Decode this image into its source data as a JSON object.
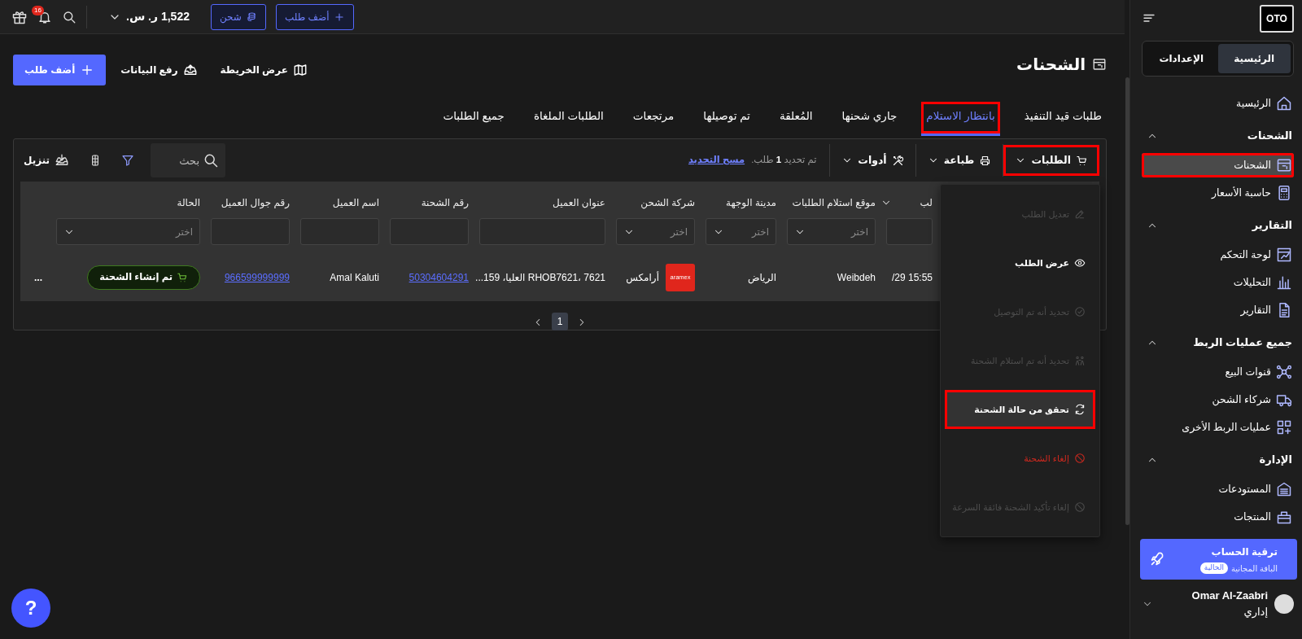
{
  "topbar": {
    "buttons": [
      {
        "label": "أضف طلب",
        "kind": "add"
      },
      {
        "label": "شحن",
        "kind": "charge"
      }
    ],
    "balance": "1,522 ر. س.",
    "notifications": "16"
  },
  "page": {
    "title": "الشحنات",
    "actions": [
      {
        "label": "عرض الخريطة",
        "kind": "map"
      },
      {
        "label": "رفع البيانات",
        "kind": "upload"
      },
      {
        "label": "أضف طلب",
        "kind": "primary"
      }
    ]
  },
  "tabs": [
    {
      "label": "طلبات قيد التنفيذ",
      "selected": false,
      "highlighted": false
    },
    {
      "label": "بانتظار الاستلام",
      "selected": true,
      "highlighted": true
    },
    {
      "label": "جاري شحنها",
      "selected": false,
      "highlighted": false
    },
    {
      "label": "المُعلقة",
      "selected": false,
      "highlighted": false
    },
    {
      "label": "تم توصيلها",
      "selected": false,
      "highlighted": false
    },
    {
      "label": "مرتجعات",
      "selected": false,
      "highlighted": false
    },
    {
      "label": "الطلبات الملغاة",
      "selected": false,
      "highlighted": false
    },
    {
      "label": "جميع الطلبات",
      "selected": false,
      "highlighted": false
    }
  ],
  "toolbar": {
    "menus": [
      {
        "label": "الطلبات",
        "highlighted": true
      },
      {
        "label": "طباعة",
        "highlighted": false
      },
      {
        "label": "أدوات",
        "highlighted": false
      }
    ],
    "selection_text": "تم تحديد **1** طلب.",
    "clear_link": "مسح التحديد",
    "search": {
      "placeholder": "بحث"
    },
    "download": "تنزيل"
  },
  "table": {
    "columns": [
      {
        "header": "لب",
        "kind": "text",
        "filter": {
          "kind": "text"
        },
        "caret": true
      },
      {
        "header": "موقع استلام الطلبات",
        "kind": "text",
        "filter": {
          "kind": "select",
          "placeholder": "اختر"
        },
        "caret": false
      },
      {
        "header": "مدينة الوجهة",
        "kind": "text",
        "filter": {
          "kind": "select",
          "placeholder": "اختر"
        },
        "caret": false
      },
      {
        "header": "شركة الشحن",
        "kind": "carrier",
        "filter": {
          "kind": "select",
          "placeholder": "اختر"
        },
        "caret": false
      },
      {
        "header": "عنوان العميل",
        "kind": "text",
        "filter": {
          "kind": "text"
        },
        "caret": false
      },
      {
        "header": "رقم الشحنة",
        "kind": "link",
        "filter": {
          "kind": "text"
        },
        "caret": false
      },
      {
        "header": "اسم العميل",
        "kind": "text",
        "filter": {
          "kind": "text"
        },
        "caret": false
      },
      {
        "header": "رقم جوال العميل",
        "kind": "link",
        "filter": {
          "kind": "text"
        },
        "caret": false
      },
      {
        "header": "الحالة",
        "kind": "status",
        "filter": {
          "kind": "select",
          "placeholder": "اختر"
        },
        "caret": false
      },
      {
        "kind": "actions",
        "caret": false
      }
    ],
    "rows": [
      {
        "cells": [
          "15:55 29/",
          "Weibdeh",
          "الرياض",
          {
            "logo": "aramex",
            "name": "أرامكس"
          },
          "RHOB7621، 7621 العليا، 159...",
          "50304604291",
          "Amal Kaluti",
          "966599999999",
          "تم إنشاء الشحنة",
          "..."
        ]
      }
    ]
  },
  "pagination": {
    "pages": [
      {
        "label": "1",
        "selected": true
      }
    ]
  },
  "dropdown": {
    "items": [
      {
        "label": "تعديل الطلب",
        "kind": "normal",
        "disabled": true,
        "hovered": false,
        "highlighted": false
      },
      {
        "label": "عرض الطلب",
        "kind": "normal",
        "disabled": false,
        "hovered": false,
        "highlighted": false
      },
      {
        "label": "تحديد أنه تم التوصيل",
        "kind": "normal",
        "disabled": true,
        "hovered": false,
        "highlighted": false
      },
      {
        "label": "تحديد أنه تم استلام الشحنة",
        "kind": "normal",
        "disabled": true,
        "hovered": false,
        "highlighted": false
      },
      {
        "label": "تحقق من حالة الشحنة",
        "kind": "normal",
        "disabled": false,
        "hovered": true,
        "highlighted": true
      },
      {
        "label": "إلغاء الشحنة",
        "kind": "danger",
        "disabled": false,
        "hovered": false,
        "highlighted": false
      },
      {
        "label": "إلغاء تأكيد الشحنة فائقة السرعة",
        "kind": "normal",
        "disabled": true,
        "hovered": false,
        "highlighted": false
      }
    ]
  },
  "sidebar": {
    "logo": "OTO",
    "switch": [
      {
        "label": "الرئيسية",
        "selected": true
      },
      {
        "label": "الإعدادات",
        "selected": false
      }
    ],
    "home": "الرئيسية",
    "sections": [
      {
        "title": "الشحنات",
        "expanded": true,
        "items": [
          {
            "label": "الشحنات",
            "selected": true,
            "highlighted": true
          },
          {
            "label": "حاسبة الأسعار",
            "selected": false,
            "highlighted": false
          }
        ]
      },
      {
        "title": "التقارير",
        "expanded": true,
        "items": [
          {
            "label": "لوحة التحكم",
            "selected": false,
            "highlighted": false
          },
          {
            "label": "التحليلات",
            "selected": false,
            "highlighted": false
          },
          {
            "label": "التقارير",
            "selected": false,
            "highlighted": false
          }
        ]
      },
      {
        "title": "جميع عمليات الربط",
        "expanded": true,
        "items": [
          {
            "label": "قنوات البيع",
            "selected": false,
            "highlighted": false
          },
          {
            "label": "شركاء الشحن",
            "selected": false,
            "highlighted": false
          },
          {
            "label": "عمليات الربط الأخرى",
            "selected": false,
            "highlighted": false
          }
        ]
      },
      {
        "title": "الإدارة",
        "expanded": true,
        "items": [
          {
            "label": "المستودعات",
            "selected": false,
            "highlighted": false
          },
          {
            "label": "المنتجات",
            "selected": false,
            "highlighted": false
          }
        ]
      }
    ],
    "upgrade": {
      "title": "ترقية الحساب",
      "plan": "الباقة المجانية",
      "badge": "الحالية"
    },
    "user": {
      "name": "Omar Al-Zaabri",
      "role": "إداري"
    }
  },
  "help_button": "?"
}
